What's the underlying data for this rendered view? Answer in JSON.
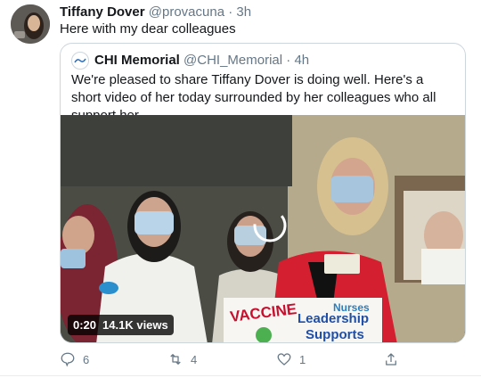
{
  "tweet": {
    "author_name": "Tiffany Dover",
    "author_handle": "@provacuna",
    "separator": "·",
    "time": "3h",
    "text": "Here with my dear colleagues"
  },
  "quoted": {
    "author_name": "CHI Memorial",
    "author_handle": "@CHI_Memorial",
    "separator": "·",
    "time": "4h",
    "text": "We're pleased to share Tiffany Dover is doing well. Here's a short video of her today surrounded by her colleagues who all support her.",
    "video": {
      "duration": "0:20",
      "views": "14.1K views",
      "sign_words": [
        "VACCINE",
        "Nurses",
        "Leadership",
        "Supports"
      ]
    }
  },
  "actions": {
    "reply_count": "6",
    "retweet_count": "4",
    "like_count": "1"
  },
  "colors": {
    "text_primary": "#14171a",
    "text_secondary": "#657786",
    "border": "#ccd6dd",
    "sign_red": "#c8102e",
    "sign_blue": "#1f4fa8"
  },
  "icons": [
    "reply-icon",
    "retweet-icon",
    "like-icon",
    "share-icon"
  ]
}
